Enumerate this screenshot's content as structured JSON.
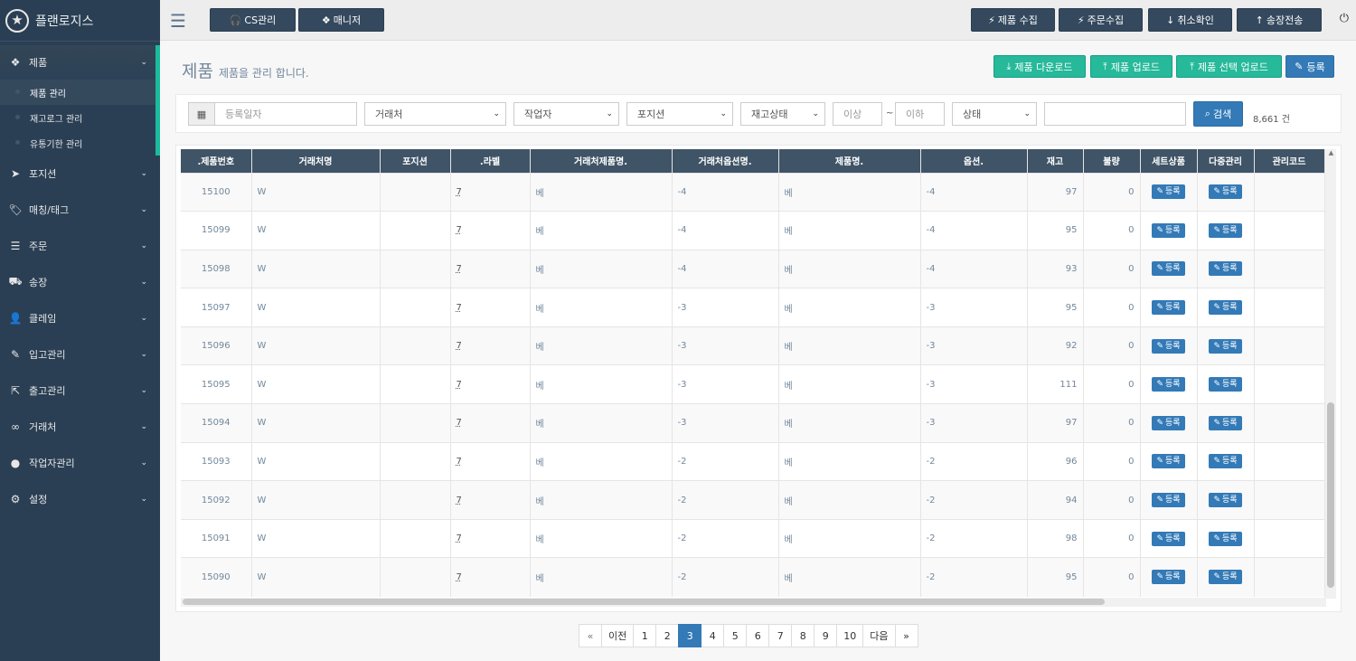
{
  "brand": {
    "name": "플랜로지스",
    "logo_icon": "star-icon"
  },
  "sidebar": {
    "items": [
      {
        "label": "제품",
        "icon": "cubes-icon"
      },
      {
        "label": "포지션",
        "icon": "location-arrow-icon"
      },
      {
        "label": "매칭/태그",
        "icon": "tag-icon"
      },
      {
        "label": "주문",
        "icon": "list-icon"
      },
      {
        "label": "송장",
        "icon": "truck-icon"
      },
      {
        "label": "클레임",
        "icon": "user-plus-icon"
      },
      {
        "label": "입고관리",
        "icon": "edit-icon"
      },
      {
        "label": "출고관리",
        "icon": "external-link-icon"
      },
      {
        "label": "거래처",
        "icon": "link-icon"
      },
      {
        "label": "작업자관리",
        "icon": "user-icon"
      },
      {
        "label": "설정",
        "icon": "gear-icon"
      }
    ],
    "submenu": [
      "제품 관리",
      "재고로그 관리",
      "유통기한 관리"
    ]
  },
  "topnav": {
    "cs": "CS관리",
    "manager": "매니저",
    "collect_product": "제품 수집",
    "collect_order": "주문수집",
    "cancel_check": "취소확인",
    "send_invoice": "송장전송"
  },
  "page": {
    "title": "제품",
    "subtitle": "제품을 관리 합니다."
  },
  "actions": {
    "download": "제품 다운로드",
    "upload": "제품 업로드",
    "select_upload": "제품 선택 업로드",
    "register": "등록"
  },
  "filters": {
    "date_placeholder": "등록일자",
    "vendor": "거래처",
    "worker": "작업자",
    "position": "포지션",
    "stock_status": "재고상태",
    "min_placeholder": "이상",
    "range_sep": "~",
    "max_placeholder": "이하",
    "status": "상태",
    "keyword": "",
    "search": "검색",
    "count": "8,661 건"
  },
  "table": {
    "headers": [
      ".제품번호",
      "거래처명",
      "포지션",
      ".라벨",
      "거래처제품명.",
      "거래처옵션명.",
      "제품명.",
      "옵션.",
      "재고",
      "불량",
      "세트상품",
      "다중관리",
      "관리코드"
    ],
    "register_label": "등록",
    "rows": [
      {
        "id": "15100",
        "vendor": "W",
        "position": "",
        "label": "7",
        "vendor_product": "베",
        "vendor_option": "-4",
        "product": "베",
        "option": "-4",
        "stock": "97",
        "defect": "0",
        "code": ""
      },
      {
        "id": "15099",
        "vendor": "W",
        "position": "",
        "label": "7",
        "vendor_product": "베",
        "vendor_option": "-4",
        "product": "베",
        "option": "-4",
        "stock": "95",
        "defect": "0",
        "code": ""
      },
      {
        "id": "15098",
        "vendor": "W",
        "position": "",
        "label": "7",
        "vendor_product": "베",
        "vendor_option": "-4",
        "product": "베",
        "option": "-4",
        "stock": "93",
        "defect": "0",
        "code": ""
      },
      {
        "id": "15097",
        "vendor": "W",
        "position": "",
        "label": "7",
        "vendor_product": "베",
        "vendor_option": "-3",
        "product": "베",
        "option": "-3",
        "stock": "95",
        "defect": "0",
        "code": ""
      },
      {
        "id": "15096",
        "vendor": "W",
        "position": "",
        "label": "7",
        "vendor_product": "베",
        "vendor_option": "-3",
        "product": "베",
        "option": "-3",
        "stock": "92",
        "defect": "0",
        "code": ""
      },
      {
        "id": "15095",
        "vendor": "W",
        "position": "",
        "label": "7",
        "vendor_product": "베",
        "vendor_option": "-3",
        "product": "베",
        "option": "-3",
        "stock": "111",
        "defect": "0",
        "code": ""
      },
      {
        "id": "15094",
        "vendor": "W",
        "position": "",
        "label": "7",
        "vendor_product": "베",
        "vendor_option": "-3",
        "product": "베",
        "option": "-3",
        "stock": "97",
        "defect": "0",
        "code": ""
      },
      {
        "id": "15093",
        "vendor": "W",
        "position": "",
        "label": "7",
        "vendor_product": "베",
        "vendor_option": "-2",
        "product": "베",
        "option": "-2",
        "stock": "96",
        "defect": "0",
        "code": ""
      },
      {
        "id": "15092",
        "vendor": "W",
        "position": "",
        "label": "7",
        "vendor_product": "베",
        "vendor_option": "-2",
        "product": "베",
        "option": "-2",
        "stock": "94",
        "defect": "0",
        "code": ""
      },
      {
        "id": "15091",
        "vendor": "W",
        "position": "",
        "label": "7",
        "vendor_product": "베",
        "vendor_option": "-2",
        "product": "베",
        "option": "-2",
        "stock": "98",
        "defect": "0",
        "code": ""
      },
      {
        "id": "15090",
        "vendor": "W",
        "position": "",
        "label": "7",
        "vendor_product": "베",
        "vendor_option": "-2",
        "product": "베",
        "option": "-2",
        "stock": "95",
        "defect": "0",
        "code": ""
      }
    ]
  },
  "pagination": {
    "first": "«",
    "prev": "이전",
    "pages": [
      "1",
      "2",
      "3",
      "4",
      "5",
      "6",
      "7",
      "8",
      "9",
      "10"
    ],
    "current": "3",
    "next": "다음",
    "last": "»"
  },
  "colors": {
    "sidebar": "#2a3f54",
    "accent": "#1abb9c",
    "primary": "#337ab7",
    "success": "#26b99a",
    "header": "#405467"
  }
}
